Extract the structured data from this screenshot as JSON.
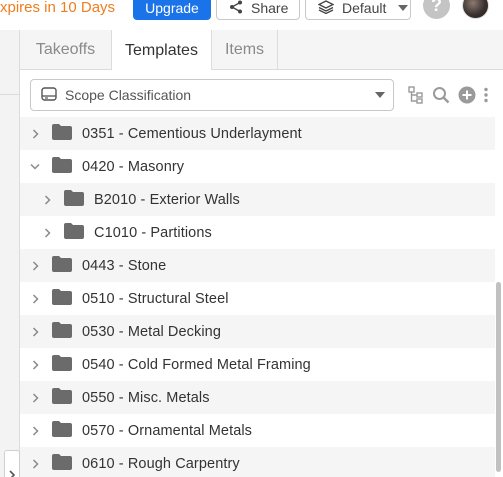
{
  "header": {
    "expires_text": "xpires in 10 Days",
    "upgrade_label": "Upgrade",
    "share_label": "Share",
    "layers_label": "Default"
  },
  "tabs": [
    {
      "label": "Takeoffs",
      "active": false
    },
    {
      "label": "Templates",
      "active": true
    },
    {
      "label": "Items",
      "active": false
    }
  ],
  "toolbar": {
    "select_value": "Scope Classification",
    "icons": [
      "hierarchy-icon",
      "search-icon",
      "add-circle-icon",
      "more-vertical-icon"
    ]
  },
  "tree": {
    "rows": [
      {
        "label": "0351 - Cementious Underlayment",
        "expanded": false,
        "level": 0
      },
      {
        "label": "0420 - Masonry",
        "expanded": true,
        "level": 0
      },
      {
        "label": "B2010 - Exterior Walls",
        "expanded": false,
        "level": 1
      },
      {
        "label": "C1010 - Partitions",
        "expanded": false,
        "level": 1
      },
      {
        "label": "0443 - Stone",
        "expanded": false,
        "level": 0
      },
      {
        "label": "0510 - Structural Steel",
        "expanded": false,
        "level": 0
      },
      {
        "label": "0530 - Metal Decking",
        "expanded": false,
        "level": 0
      },
      {
        "label": "0540 - Cold Formed Metal Framing",
        "expanded": false,
        "level": 0
      },
      {
        "label": "0550 - Misc. Metals",
        "expanded": false,
        "level": 0
      },
      {
        "label": "0570 - Ornamental Metals",
        "expanded": false,
        "level": 0
      },
      {
        "label": "0610 - Rough Carpentry",
        "expanded": false,
        "level": 0
      }
    ]
  },
  "colors": {
    "accent": "#1a73e8",
    "warning": "#f07d1e",
    "folder": "#6b6b6b"
  }
}
